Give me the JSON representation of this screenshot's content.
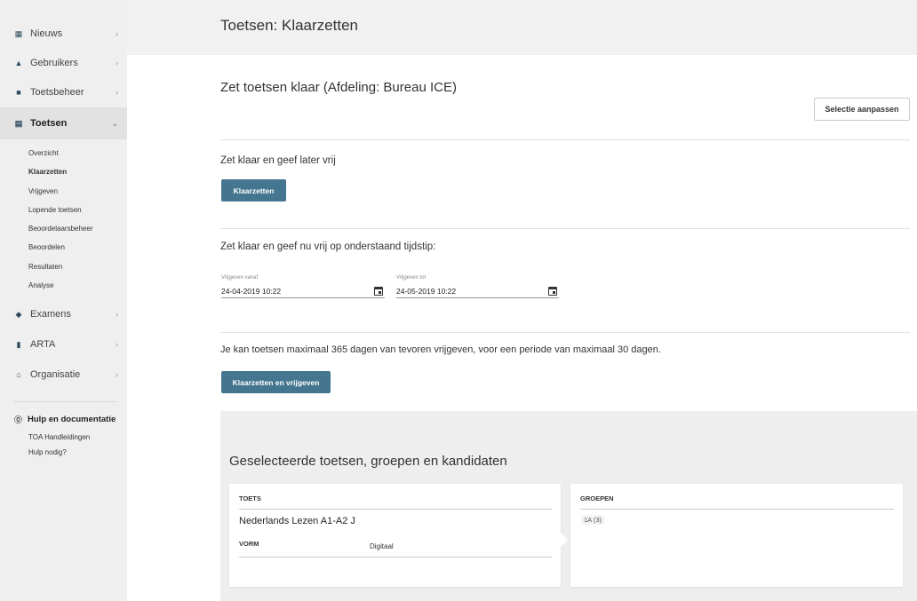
{
  "sidebar": {
    "items": [
      {
        "label": "Nieuws",
        "icon": "news-icon",
        "glyph": "▦"
      },
      {
        "label": "Gebruikers",
        "icon": "users-icon",
        "glyph": "👥"
      },
      {
        "label": "Toetsbeheer",
        "icon": "briefcase-icon",
        "glyph": "■"
      },
      {
        "label": "Toetsen",
        "icon": "document-icon",
        "glyph": "▤"
      },
      {
        "label": "Examens",
        "icon": "graduation-cap-icon",
        "glyph": "◆"
      },
      {
        "label": "ARTA",
        "icon": "book-icon",
        "glyph": "▮"
      },
      {
        "label": "Organisatie",
        "icon": "institution-icon",
        "glyph": "⌂"
      }
    ],
    "toetsen_sub": [
      "Overzicht",
      "Klaarzetten",
      "Vrijgeven",
      "Lopende toetsen",
      "Beoordelaarsbeheer",
      "Beoordelen",
      "Resultaten",
      "Analyse"
    ],
    "help": {
      "title": "Hulp en documentatie",
      "links": [
        "TOA Handleidingen",
        "Hulp nodig?"
      ]
    }
  },
  "header": {
    "title": "Toetsen: Klaarzetten"
  },
  "main": {
    "heading": "Zet toetsen klaar (Afdeling: Bureau ICE)",
    "selectie_button": "Selectie aanpassen",
    "section1": {
      "title": "Zet klaar en geef later vrij",
      "button": "Klaarzetten"
    },
    "section2": {
      "title": "Zet klaar en geef nu vrij op onderstaand tijdstip:",
      "from_label": "Vrijgeven vanaf",
      "from_value": "24-04-2019 10:22",
      "to_label": "Vrijgeven tot",
      "to_value": "24-05-2019 10:22"
    },
    "note": "Je kan toetsen maximaal 365 dagen van tevoren vrijgeven, voor een periode van maximaal 30 dagen.",
    "release_button": "Klaarzetten en vrijgeven"
  },
  "selection": {
    "title": "Geselecteerde toetsen, groepen en kandidaten",
    "toets_label": "TOETS",
    "toets_name": "Nederlands Lezen A1-A2 J",
    "vorm_label": "VORM",
    "vorm_value": "Digitaal",
    "groepen_label": "GROEPEN",
    "groepen": [
      "1A (3)"
    ]
  },
  "colors": {
    "primary_button": "#44768f",
    "sidebar_bg": "#efefef",
    "panel_bg": "#eeeeee"
  }
}
